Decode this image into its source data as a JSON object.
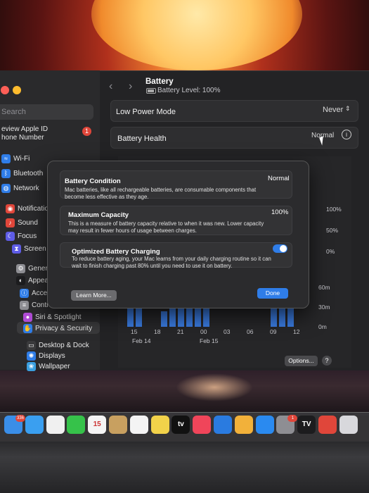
{
  "window": {
    "title": "Battery",
    "subtitle": "Battery Level: 100%"
  },
  "sidebar": {
    "search_placeholder": "Search",
    "apple_id": {
      "line1": "eview Apple ID",
      "line2": "hone Number",
      "badge": "1"
    },
    "items": [
      {
        "label": "Wi-Fi",
        "icon": "wifi-icon",
        "color": "#2f7de8"
      },
      {
        "label": "Bluetooth",
        "icon": "bluetooth-icon",
        "color": "#2f7de8"
      },
      {
        "label": "Network",
        "icon": "globe-icon",
        "color": "#2f7de8"
      },
      {
        "label": "Notification",
        "icon": "bell-icon",
        "color": "#e0463a"
      },
      {
        "label": "Sound",
        "icon": "speaker-icon",
        "color": "#e0463a"
      },
      {
        "label": "Focus",
        "icon": "moon-icon",
        "color": "#5e5ce6"
      },
      {
        "label": "Screen Tim",
        "icon": "hourglass-icon",
        "color": "#5e5ce6"
      },
      {
        "label": "General",
        "icon": "gear-icon",
        "color": "#8e8e93"
      },
      {
        "label": "Appearanc",
        "icon": "appearance-icon",
        "color": "#1c1c1e"
      },
      {
        "label": "Accessibili",
        "icon": "accessibility-icon",
        "color": "#2f7de8"
      },
      {
        "label": "Control Ce",
        "icon": "control-center-icon",
        "color": "#8e8e93"
      },
      {
        "label": "Siri & Spotlight",
        "icon": "siri-icon",
        "color": "#b04cd6"
      },
      {
        "label": "Privacy & Security",
        "icon": "hand-icon",
        "color": "#2f7de8"
      },
      {
        "label": "Desktop & Dock",
        "icon": "dock-icon",
        "color": "#3a3a3c"
      },
      {
        "label": "Displays",
        "icon": "display-icon",
        "color": "#2f7de8"
      },
      {
        "label": "Wallpaper",
        "icon": "wallpaper-icon",
        "color": "#3aa0e0"
      }
    ]
  },
  "settings": {
    "low_power_label": "Low Power Mode",
    "low_power_value": "Never",
    "battery_health_label": "Battery Health",
    "battery_health_value": "Normal"
  },
  "modal": {
    "condition_title": "Battery Condition",
    "condition_value": "Normal",
    "condition_desc": "Mac batteries, like all rechargeable batteries, are consumable components that become less effective as they age.",
    "capacity_title": "Maximum Capacity",
    "capacity_value": "100%",
    "capacity_desc": "This is a measure of battery capacity relative to when it was new. Lower capacity may result in fewer hours of usage between charges.",
    "optimized_title": "Optimized Battery Charging",
    "optimized_on": true,
    "optimized_desc": "To reduce battery aging, your Mac learns from your daily charging routine so it can wait to finish charging past 80% until you need to use it on battery.",
    "learn_more": "Learn More...",
    "done": "Done"
  },
  "chart_data": [
    {
      "type": "bar",
      "title": "",
      "y_ticks": [
        "100%",
        "50%",
        "0%"
      ],
      "series": [
        {
          "values": [
            0,
            0,
            0,
            0,
            0,
            0,
            0,
            0,
            0,
            0,
            0,
            0,
            0,
            0,
            0,
            0,
            0,
            0,
            0,
            0,
            0,
            0,
            0,
            0,
            0,
            0,
            0,
            0,
            0,
            0,
            0,
            0,
            0,
            0,
            0,
            0,
            0,
            0,
            0,
            0,
            0,
            0,
            0,
            0,
            0,
            0,
            0,
            0,
            0,
            0,
            0,
            0,
            0,
            0,
            0,
            0,
            0,
            0,
            0,
            0,
            0,
            0,
            0,
            0,
            0,
            0,
            0,
            0,
            0,
            0,
            0,
            0,
            0,
            0,
            0,
            0,
            0,
            0,
            0,
            0,
            0,
            0,
            0,
            0,
            0,
            0,
            0,
            100,
            100,
            100
          ]
        }
      ]
    },
    {
      "type": "bar",
      "title": "",
      "y_ticks": [
        "60m",
        "30m",
        "0m"
      ],
      "x_ticks": [
        "15",
        "18",
        "21",
        "00",
        "03",
        "06",
        "09",
        "12"
      ],
      "x_dates": [
        "Feb 14",
        "Feb 15"
      ],
      "series": [
        {
          "values": [
            60,
            60,
            0,
            0,
            20,
            60,
            60,
            60,
            60,
            60,
            0,
            0,
            0,
            0,
            0,
            0,
            0,
            60,
            60,
            60
          ]
        }
      ]
    }
  ],
  "footer": {
    "options": "Options...",
    "help": "?"
  },
  "dock": [
    {
      "label": "",
      "icon": "mail-icon",
      "color": "#3a8ee8",
      "badge": "336"
    },
    {
      "label": "",
      "icon": "safari-icon",
      "color": "#3a9ff0",
      "badge": ""
    },
    {
      "label": "",
      "icon": "photos-icon",
      "color": "#f0f0f0",
      "badge": ""
    },
    {
      "label": "",
      "icon": "facetime-icon",
      "color": "#36c24a",
      "badge": ""
    },
    {
      "label": "15",
      "icon": "calendar-icon",
      "color": "#f4f4f4",
      "badge": ""
    },
    {
      "label": "",
      "icon": "contacts-icon",
      "color": "#c8a060",
      "badge": ""
    },
    {
      "label": "",
      "icon": "reminders-icon",
      "color": "#f4f4f4",
      "badge": ""
    },
    {
      "label": "",
      "icon": "notes-icon",
      "color": "#f2d24a",
      "badge": ""
    },
    {
      "label": "tv",
      "icon": "apple-tv-icon",
      "color": "#111111",
      "badge": ""
    },
    {
      "label": "",
      "icon": "music-icon",
      "color": "#f0455a",
      "badge": ""
    },
    {
      "label": "",
      "icon": "keynote-icon",
      "color": "#2a7be0",
      "badge": ""
    },
    {
      "label": "",
      "icon": "pencil-icon",
      "color": "#f2b13a",
      "badge": ""
    },
    {
      "label": "",
      "icon": "app-store-icon",
      "color": "#2a8af0",
      "badge": ""
    },
    {
      "label": "",
      "icon": "system-settings-icon",
      "color": "#8e8e93",
      "badge": "1"
    },
    {
      "label": "TV",
      "icon": "tradingview-icon",
      "color": "#1c1c1e",
      "badge": ""
    },
    {
      "label": "",
      "icon": "app-icon",
      "color": "#e0463a",
      "badge": ""
    },
    {
      "label": "",
      "icon": "finder-icon",
      "color": "#d8d8dc",
      "badge": ""
    }
  ]
}
